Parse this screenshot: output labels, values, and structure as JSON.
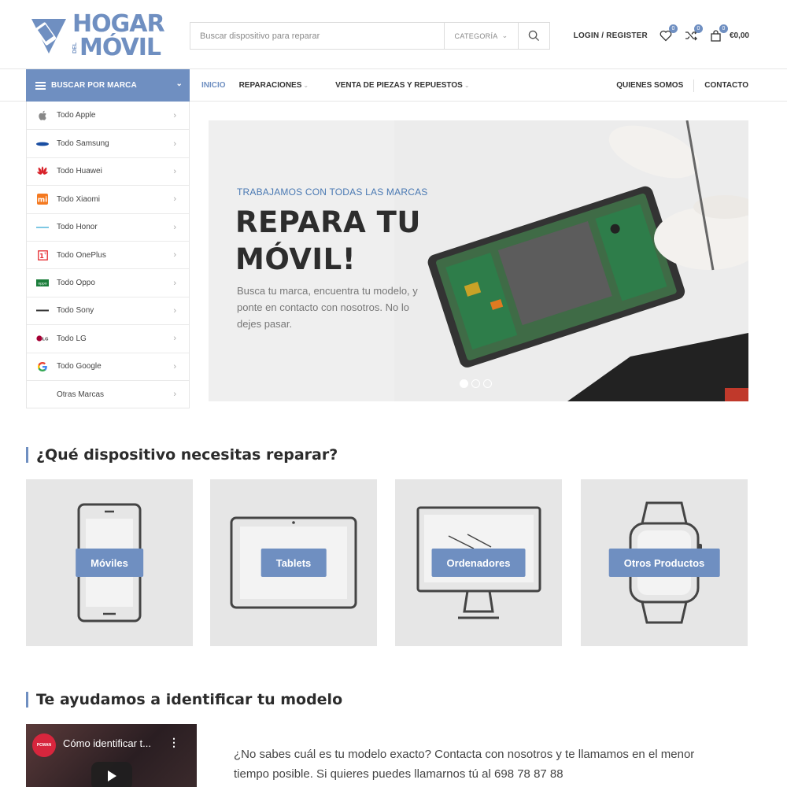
{
  "logo": {
    "line1": "HOGAR",
    "line2_small": "DEL",
    "line2": "MÓVIL"
  },
  "search": {
    "placeholder": "Buscar dispositivo para reparar",
    "category": "CATEGORÍA"
  },
  "header": {
    "login": "LOGIN / REGISTER",
    "wishlist_count": "0",
    "compare_count": "0",
    "cart_count": "0",
    "cart_total": "€0,00"
  },
  "nav": {
    "brand_button": "BUSCAR POR MARCA",
    "links": [
      "INICIO",
      "REPARACIONES",
      "VENTA DE PIEZAS Y REPUESTOS"
    ],
    "right": [
      "QUIENES SOMOS",
      "CONTACTO"
    ]
  },
  "sidebar": {
    "items": [
      {
        "label": "Todo Apple",
        "icon": "apple-icon"
      },
      {
        "label": "Todo Samsung",
        "icon": "samsung-icon"
      },
      {
        "label": "Todo Huawei",
        "icon": "huawei-icon"
      },
      {
        "label": "Todo Xiaomi",
        "icon": "xiaomi-icon"
      },
      {
        "label": "Todo Honor",
        "icon": "honor-icon"
      },
      {
        "label": "Todo OnePlus",
        "icon": "oneplus-icon"
      },
      {
        "label": "Todo Oppo",
        "icon": "oppo-icon"
      },
      {
        "label": "Todo Sony",
        "icon": "sony-icon"
      },
      {
        "label": "Todo LG",
        "icon": "lg-icon"
      },
      {
        "label": "Todo Google",
        "icon": "google-icon"
      },
      {
        "label": "Otras Marcas",
        "icon": ""
      }
    ]
  },
  "hero": {
    "kicker": "TRABAJAMOS CON TODAS LAS MARCAS",
    "title_line1": "REPARA TU",
    "title_line2": "MÓVIL!",
    "description": "Busca tu marca, encuentra tu modelo, y ponte en contacto con nosotros. No lo dejes pasar.",
    "slides": 3,
    "active_slide": 1
  },
  "devices": {
    "title": "¿Qué dispositivo necesitas reparar?",
    "items": [
      "Móviles",
      "Tablets",
      "Ordenadores",
      "Otros Productos"
    ]
  },
  "identify": {
    "title": "Te ayudamos a identificar tu modelo",
    "video_title": "Cómo identificar t...",
    "video_channel_logo": "PCMAN",
    "text": "¿No sabes cuál es tu modelo exacto? Contacta con nosotros y te llamamos en el menor tiempo posible. Si quieres puedes llamarnos tú al 698 78 87 88"
  },
  "colors": {
    "accent": "#6f8fc1",
    "card_bg": "#e6e6e6"
  }
}
